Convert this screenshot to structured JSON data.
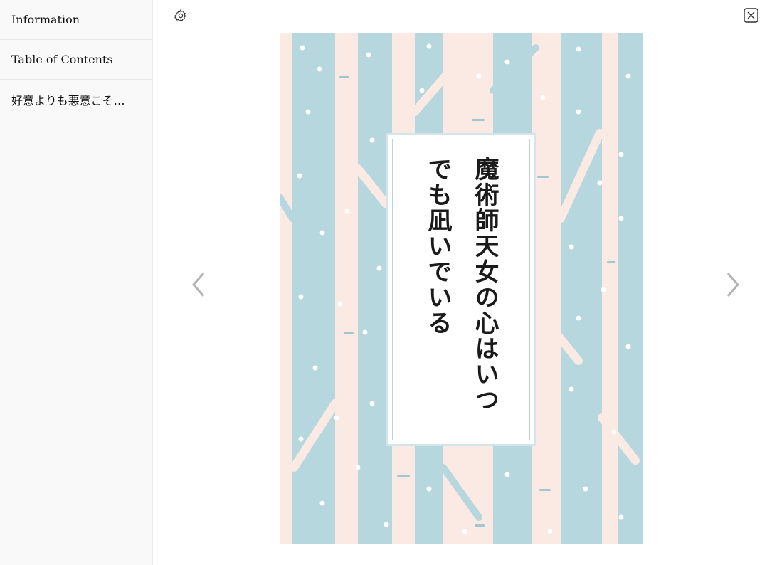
{
  "sidebar": {
    "items": [
      {
        "label": "Information"
      },
      {
        "label": "Table of Contents"
      },
      {
        "label": "好意よりも悪意こそ…"
      }
    ]
  },
  "reader": {
    "settings_icon": "gear-icon",
    "close_icon": "close-icon",
    "prev_icon": "chevron-left-icon",
    "next_icon": "chevron-right-icon"
  },
  "cover": {
    "title_line1": "魔術師天女の心はいつ",
    "title_line2": "でも凪いでいる",
    "colors": {
      "background": "#fbe9e3",
      "tree_blue": "#b7d7df",
      "tree_dark": "#a3c5cf",
      "snow": "#ffffff",
      "title_frame": "#d3e5ea"
    }
  }
}
